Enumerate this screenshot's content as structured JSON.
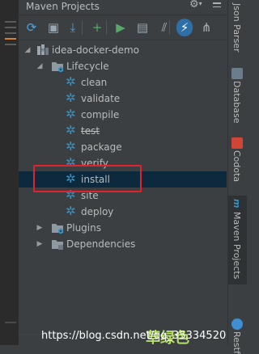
{
  "panel": {
    "title": "Maven Projects",
    "gear_glyph": "⚙",
    "gear_caret": "▾"
  },
  "toolbar": {
    "buttons": [
      {
        "name": "reimport-icon",
        "glyph": "⟳",
        "color": "#4aa3df"
      },
      {
        "name": "generate-sources-icon",
        "glyph": "▣",
        "color": "#9aa7b0"
      },
      {
        "name": "download-sources-icon",
        "glyph": "⤓",
        "color": "#4aa3df"
      },
      {
        "name": "add-project-icon",
        "glyph": "+",
        "color": "#59a869"
      },
      {
        "name": "run-goal-icon",
        "glyph": "▶",
        "color": "#59a869"
      },
      {
        "name": "execute-goal-icon",
        "glyph": "▤",
        "color": "#9aa7b0"
      },
      {
        "name": "toggle-offline-icon",
        "glyph": "⫽",
        "color": "#afb1b3"
      },
      {
        "name": "skip-tests-icon",
        "glyph": "⚡",
        "color": "#ffffff"
      },
      {
        "name": "show-dependencies-icon",
        "glyph": "⋔",
        "color": "#afb1b3"
      }
    ]
  },
  "tree": {
    "project": "idea-docker-demo",
    "lifecycle": "Lifecycle",
    "goals": [
      "clean",
      "validate",
      "compile",
      "test",
      "package",
      "verify",
      "install",
      "site",
      "deploy"
    ],
    "plugins": "Plugins",
    "dependencies": "Dependencies",
    "expanded_glyph": "◢",
    "collapsed_glyph": "▶",
    "gear_glyph": "✲"
  },
  "right_tabs": {
    "json_parser": "Json Parser",
    "database": "Database",
    "codota": "Codota",
    "maven_projects": "Maven Projects",
    "rest": "Restf"
  },
  "watermark": {
    "url": "https://blog.csdn.net/qq_35334520",
    "cn": "草绿色"
  },
  "colors": {
    "selected_row": "#0d293e",
    "highlight_box": "#e0232e",
    "gear_icon": "#3592c4"
  }
}
